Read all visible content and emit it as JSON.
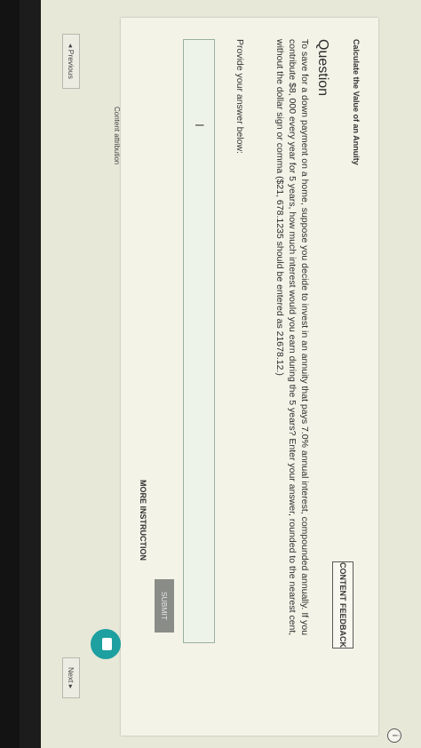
{
  "header": {
    "info_icon": "i"
  },
  "activity": {
    "title": "Calculate the Value of an Annuity"
  },
  "content_feedback_label": "CONTENT FEEDBACK",
  "question": {
    "heading": "Question",
    "text": "To save for a down payment on a home, suppose you decide to invest in an annuity that pays 7.0% annual interest, compounded annually. If you contribute $8, 000 every year for 5 years, how much interest would you earn during the 5 years? Enter your answer, rounded to the nearest cent, without the dollar sign or comma ($21, 678.1235 should be entered as 21678.12.)",
    "prompt": "Provide your answer below:"
  },
  "answer_input": {
    "value": "",
    "cursor_glyph": "I"
  },
  "submit_label": "SUBMIT",
  "more_instruction_label": "MORE INSTRUCTION",
  "content_attribution": "Content attribution",
  "nav": {
    "previous": "◂ Previous",
    "next": "Next ▸"
  },
  "colors": {
    "accent": "#1e9fa0",
    "submit_bg": "#8a8c88",
    "page_bg": "#e7e8d8"
  },
  "icons": {
    "chat": "chat-bubble-icon",
    "info": "info-icon"
  }
}
